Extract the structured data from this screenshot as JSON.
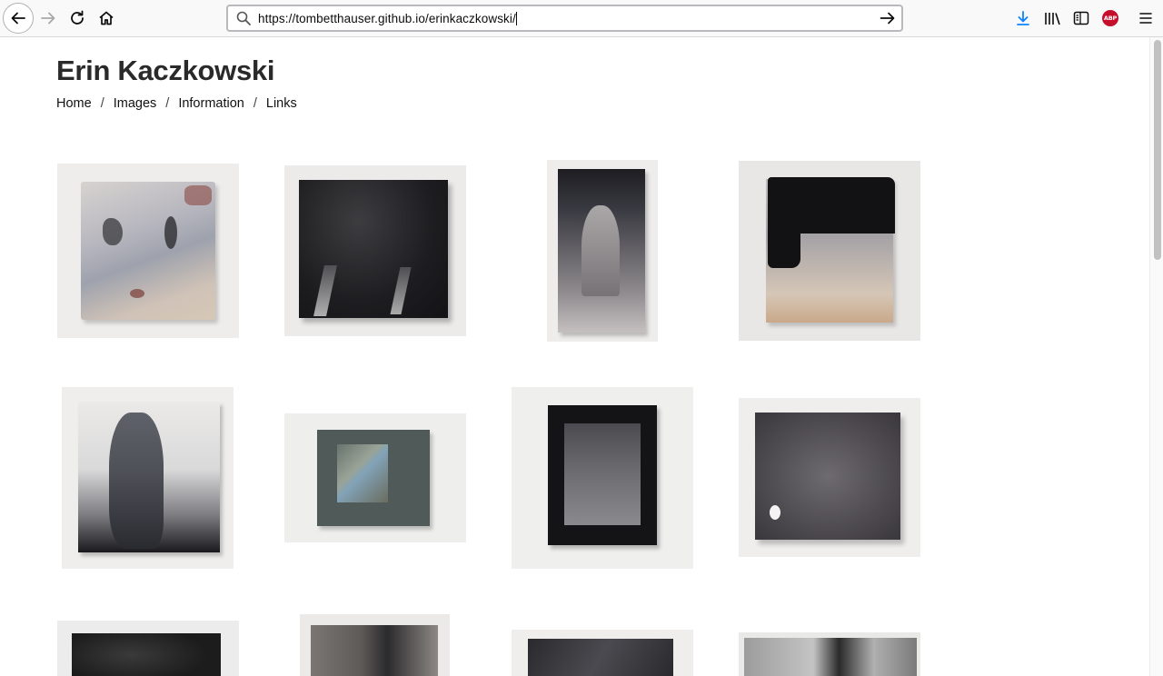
{
  "browser": {
    "url": "https://tombetthauser.github.io/erinkaczkowski/",
    "icons": [
      "back-icon",
      "forward-icon",
      "reload-icon",
      "home-icon",
      "search-icon",
      "go-arrow-icon",
      "download-icon",
      "library-icon",
      "sidebar-icon",
      "adblock-icon",
      "menu-icon"
    ],
    "adblock_badge": "ABP",
    "colors": {
      "download": "#0a84ff",
      "adblock": "#c70d2c"
    }
  },
  "page": {
    "title": "Erin Kaczkowski",
    "nav": [
      {
        "label": "Home"
      },
      {
        "label": "Images"
      },
      {
        "label": "Information"
      },
      {
        "label": "Links"
      }
    ],
    "separator": "/"
  },
  "gallery": {
    "row_count_visible": 3,
    "columns": 4
  }
}
